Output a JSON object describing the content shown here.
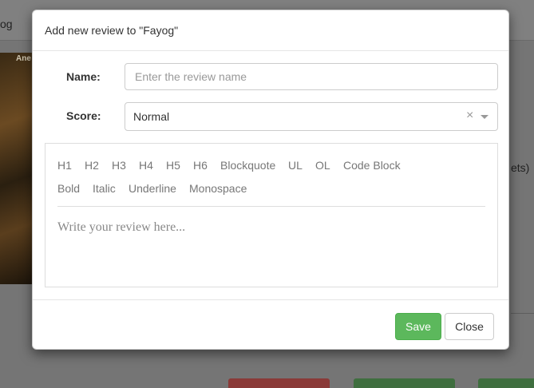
{
  "background": {
    "topbar_text": "og",
    "poster_text": "Ane",
    "side_text": "ets)"
  },
  "modal": {
    "title": "Add new review to \"Fayog\"",
    "name_label": "Name:",
    "name_placeholder": "Enter the review name",
    "name_value": "",
    "score_label": "Score:",
    "score_value": "Normal",
    "score_clear": "×",
    "toolbar_row1": [
      "H1",
      "H2",
      "H3",
      "H4",
      "H5",
      "H6",
      "Blockquote",
      "UL",
      "OL",
      "Code Block"
    ],
    "toolbar_row2": [
      "Bold",
      "Italic",
      "Underline",
      "Monospace"
    ],
    "editor_placeholder": "Write your review here...",
    "save_label": "Save",
    "close_label": "Close"
  },
  "colors": {
    "overlay": "#757575",
    "save_button": "#5cb85c",
    "close_button": "#ffffff"
  }
}
